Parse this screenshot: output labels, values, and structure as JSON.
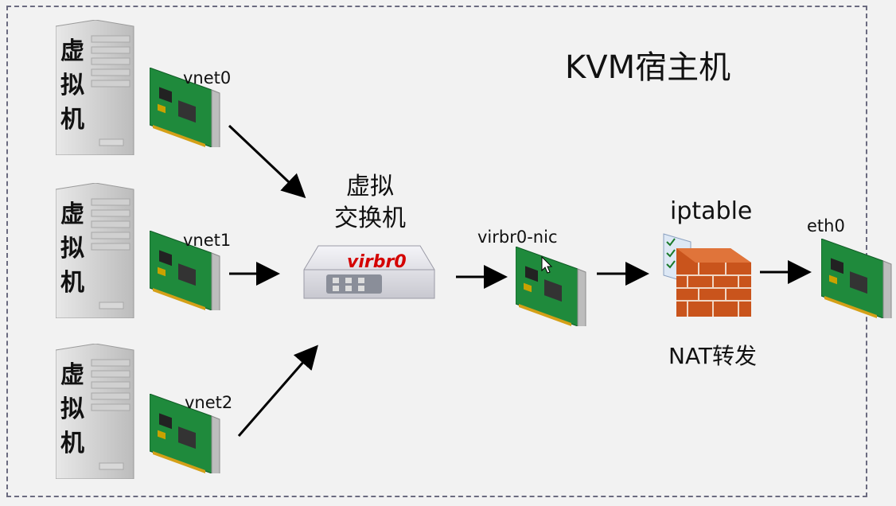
{
  "title": "KVM宿主机",
  "vms": [
    {
      "label": "虚拟机",
      "nic": "vnet0"
    },
    {
      "label": "虚拟机",
      "nic": "vnet1"
    },
    {
      "label": "虚拟机",
      "nic": "vnet2"
    }
  ],
  "switch": {
    "title": "虚拟\n交换机",
    "name": "virbr0"
  },
  "bridge_nic": "virbr0-nic",
  "firewall": {
    "label": "iptable",
    "caption": "NAT转发"
  },
  "uplink_nic": "eth0"
}
